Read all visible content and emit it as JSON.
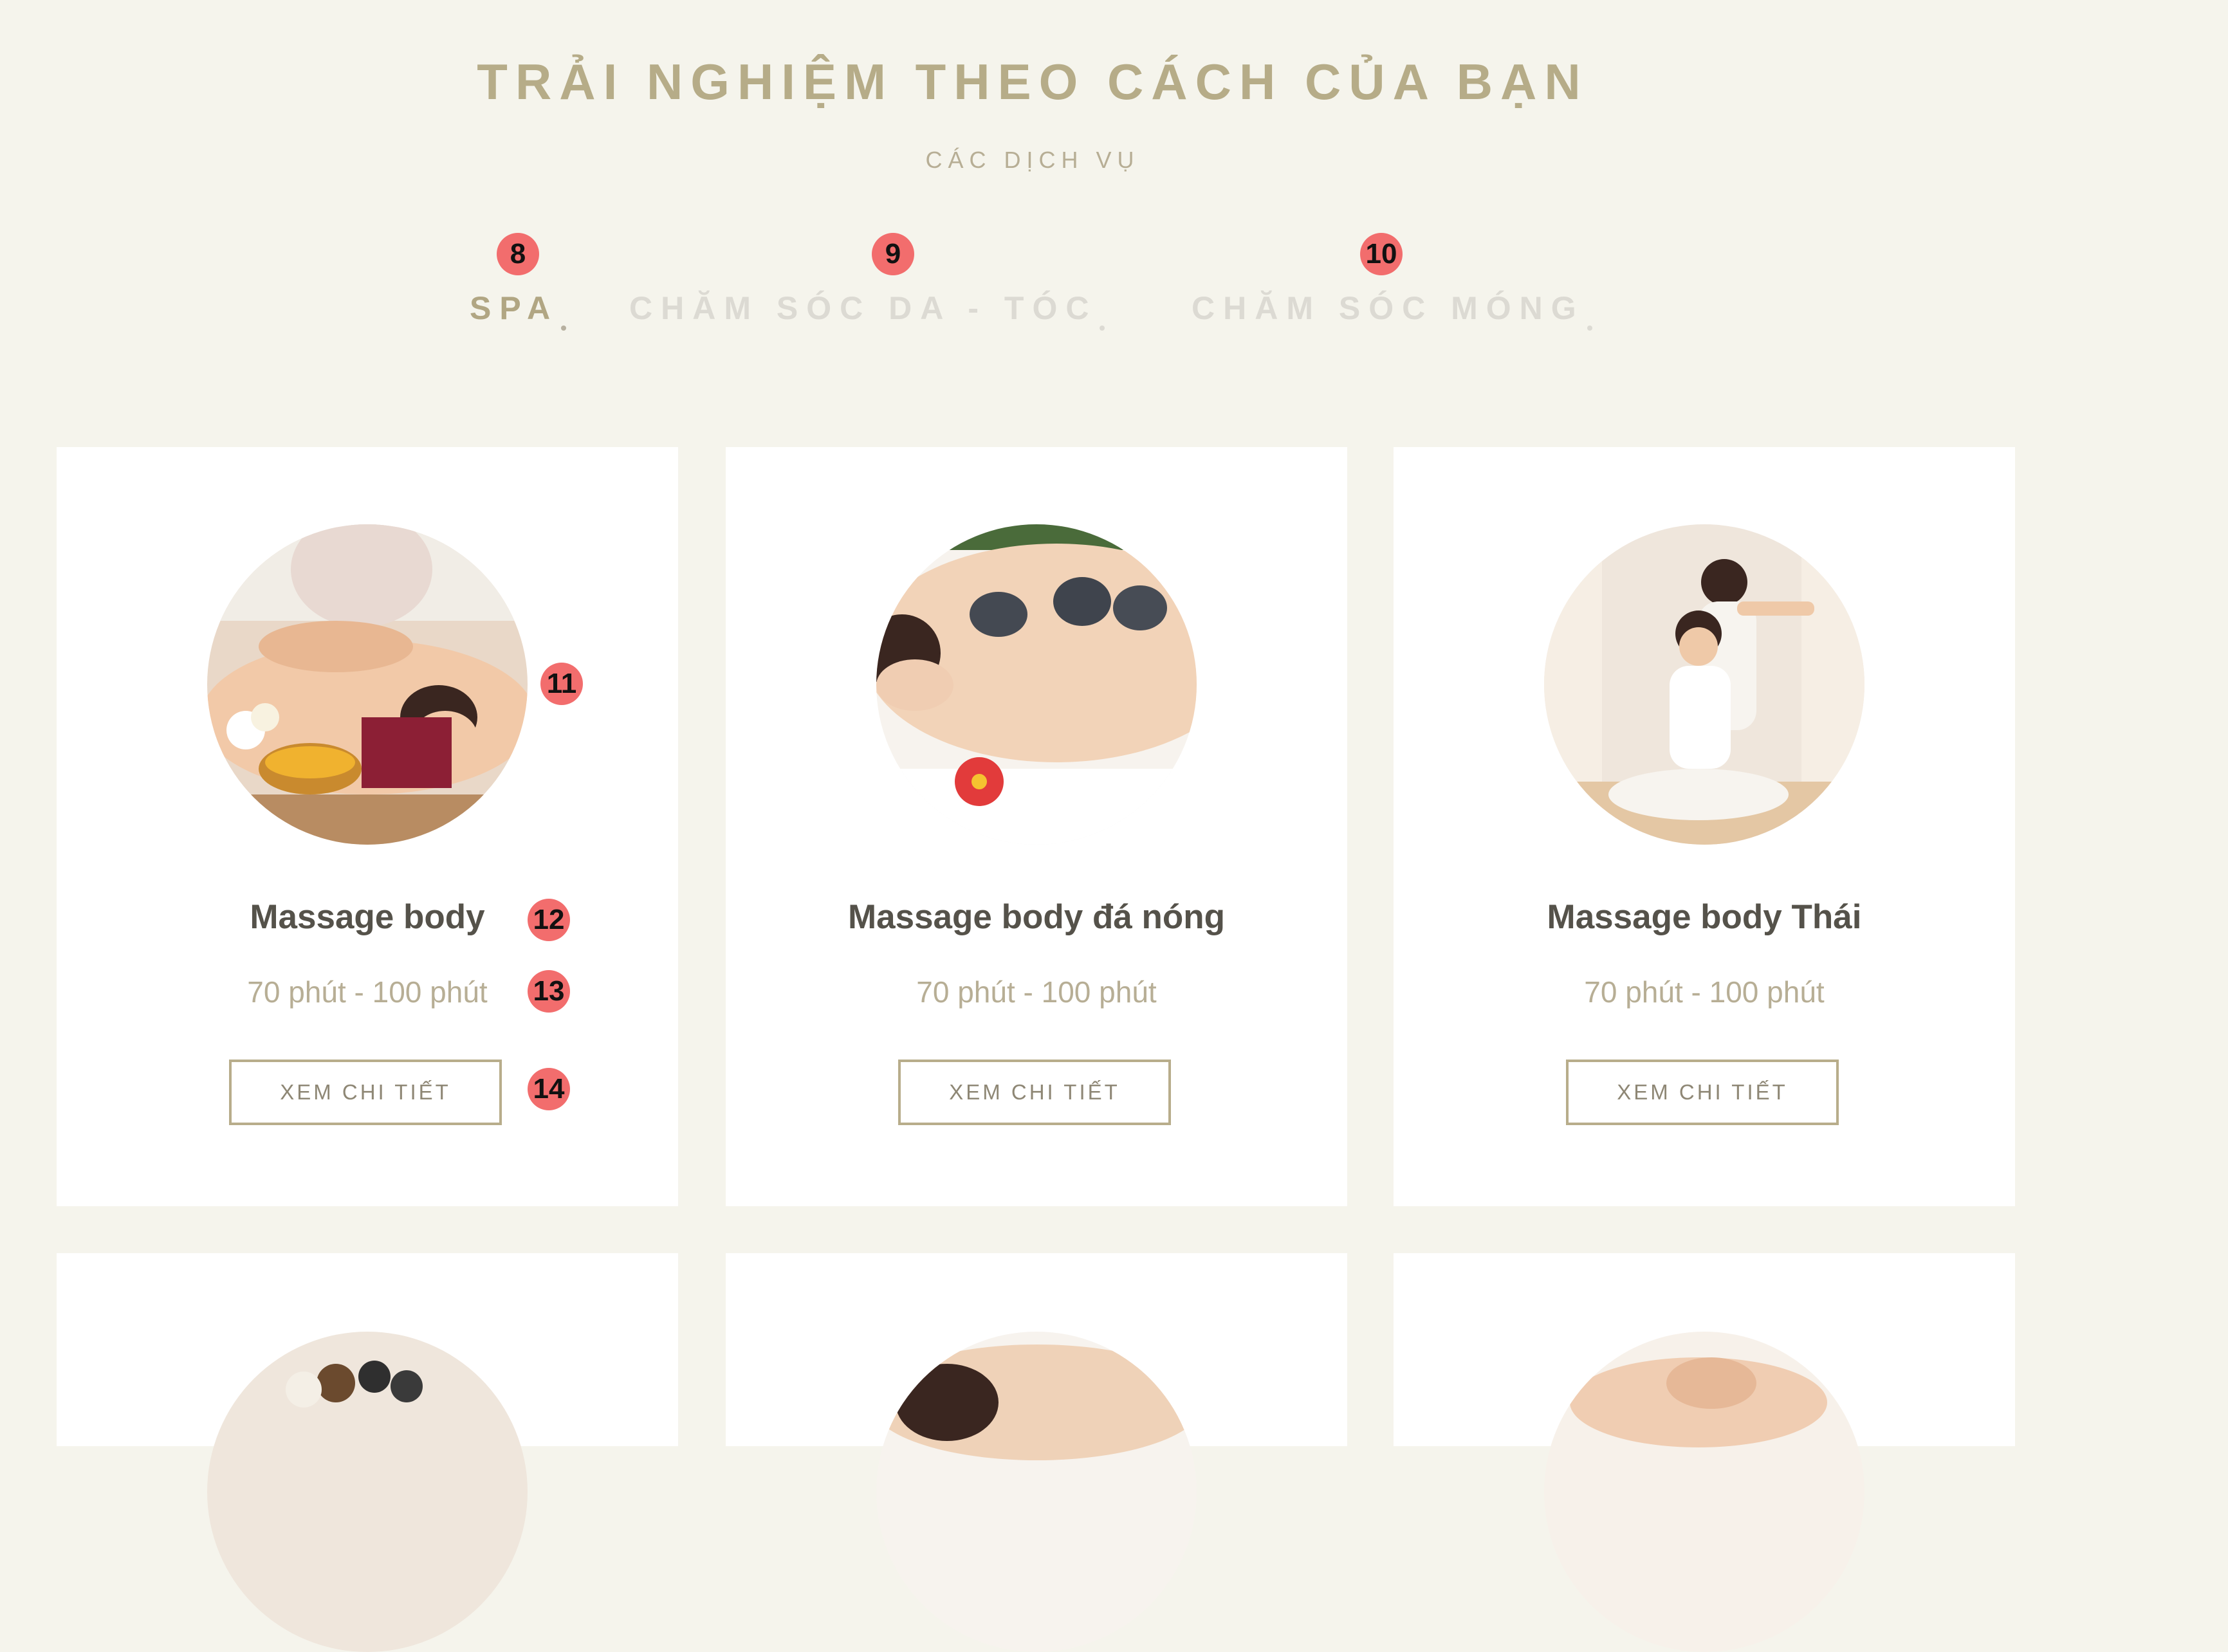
{
  "header": {
    "title": "TRẢI NGHIỆM THEO CÁCH CỦA BẠN",
    "subtitle": "CÁC DỊCH VỤ"
  },
  "tabs": [
    {
      "label": "SPA",
      "active": true,
      "marker": "8"
    },
    {
      "label": "CHĂM SÓC DA - TÓC",
      "active": false,
      "marker": "9"
    },
    {
      "label": "CHĂM SÓC MÓNG",
      "active": false,
      "marker": "10"
    }
  ],
  "cards": [
    {
      "title": "Massage body",
      "duration": "70 phút - 100 phút",
      "button": "XEM CHI TIẾT"
    },
    {
      "title": "Massage body đá nóng",
      "duration": "70 phút - 100 phút",
      "button": "XEM CHI TIẾT"
    },
    {
      "title": "Massage body Thái",
      "duration": "70 phút - 100 phút",
      "button": "XEM CHI TIẾT"
    }
  ],
  "markers": {
    "image": "11",
    "title": "12",
    "duration": "13",
    "button": "14"
  },
  "colors": {
    "background": "#f5f4ec",
    "accent": "#b1a683",
    "card": "#ffffff",
    "title_text": "#55524a",
    "marker": "#f26d6d"
  }
}
